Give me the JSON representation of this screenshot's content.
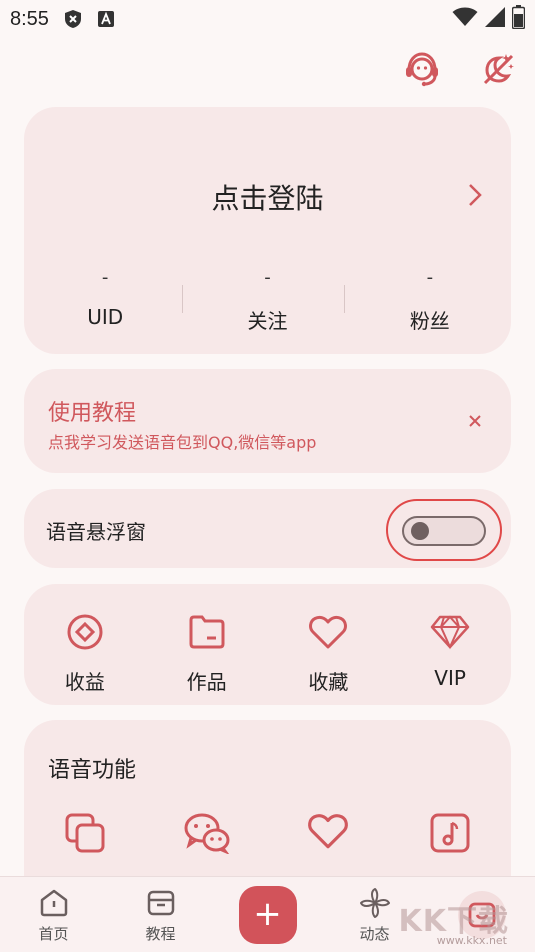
{
  "status_bar": {
    "time": "8:55",
    "icons": [
      "shield-x-icon",
      "a-notification-icon",
      "wifi-icon",
      "signal-icon",
      "battery-icon"
    ]
  },
  "top_actions": {
    "icons": [
      "headset-support-icon",
      "night-mode-icon"
    ]
  },
  "login": {
    "title": "点击登陆",
    "stats": [
      {
        "value": "-",
        "label": "UID"
      },
      {
        "value": "-",
        "label": "关注"
      },
      {
        "value": "-",
        "label": "粉丝"
      }
    ]
  },
  "tutorial": {
    "title": "使用教程",
    "subtitle": "点我学习发送语音包到QQ,微信等app"
  },
  "floating_window": {
    "label": "语音悬浮窗",
    "enabled": false
  },
  "shortcuts": [
    {
      "label": "收益",
      "icon": "earnings-icon"
    },
    {
      "label": "作品",
      "icon": "folder-icon"
    },
    {
      "label": "收藏",
      "icon": "heart-icon"
    },
    {
      "label": "VIP",
      "icon": "diamond-icon"
    }
  ],
  "voice": {
    "title": "语音功能",
    "icons": [
      "copy-icon",
      "wechat-icon",
      "heart-icon",
      "music-note-icon"
    ]
  },
  "bottom_nav": [
    {
      "label": "首页",
      "icon": "home-icon"
    },
    {
      "label": "教程",
      "icon": "box-icon"
    },
    {
      "label": "",
      "icon": "add-icon"
    },
    {
      "label": "动态",
      "icon": "pinwheel-icon"
    },
    {
      "label": "",
      "icon": "profile-icon"
    }
  ],
  "watermark": {
    "text": "KK下载",
    "url": "www.kkx.net"
  },
  "colors": {
    "accent": "#d0585d",
    "card": "#f7e8e8",
    "background": "#fcf7f6",
    "highlight_ring": "#e04848"
  }
}
